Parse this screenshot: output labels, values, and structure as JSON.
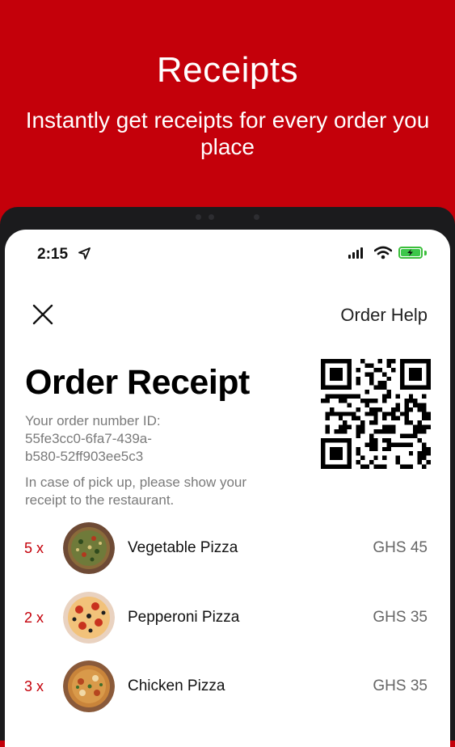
{
  "hero": {
    "title": "Receipts",
    "subtitle": "Instantly get receipts for every order you place"
  },
  "status_bar": {
    "time": "2:15"
  },
  "header": {
    "help_label": "Order Help"
  },
  "receipt": {
    "title": "Order Receipt",
    "order_label": "Your order number ID:",
    "order_id_line1": "55fe3cc0-6fa7-439a-",
    "order_id_line2": "b580-52ff903ee5c3",
    "pickup_line1": "In case of pick up, please show your",
    "pickup_line2": "receipt to the restaurant."
  },
  "items": [
    {
      "qty": "5 x",
      "name": "Vegetable Pizza",
      "price": "GHS 45"
    },
    {
      "qty": "2 x",
      "name": "Pepperoni Pizza",
      "price": "GHS 35"
    },
    {
      "qty": "3 x",
      "name": "Chicken Pizza",
      "price": "GHS 35"
    }
  ],
  "colors": {
    "brand_red": "#c4000a",
    "battery_green": "#3cc74a"
  },
  "icons": [
    "location-arrow-icon",
    "signal-icon",
    "wifi-icon",
    "battery-icon",
    "close-icon",
    "qr-code"
  ]
}
